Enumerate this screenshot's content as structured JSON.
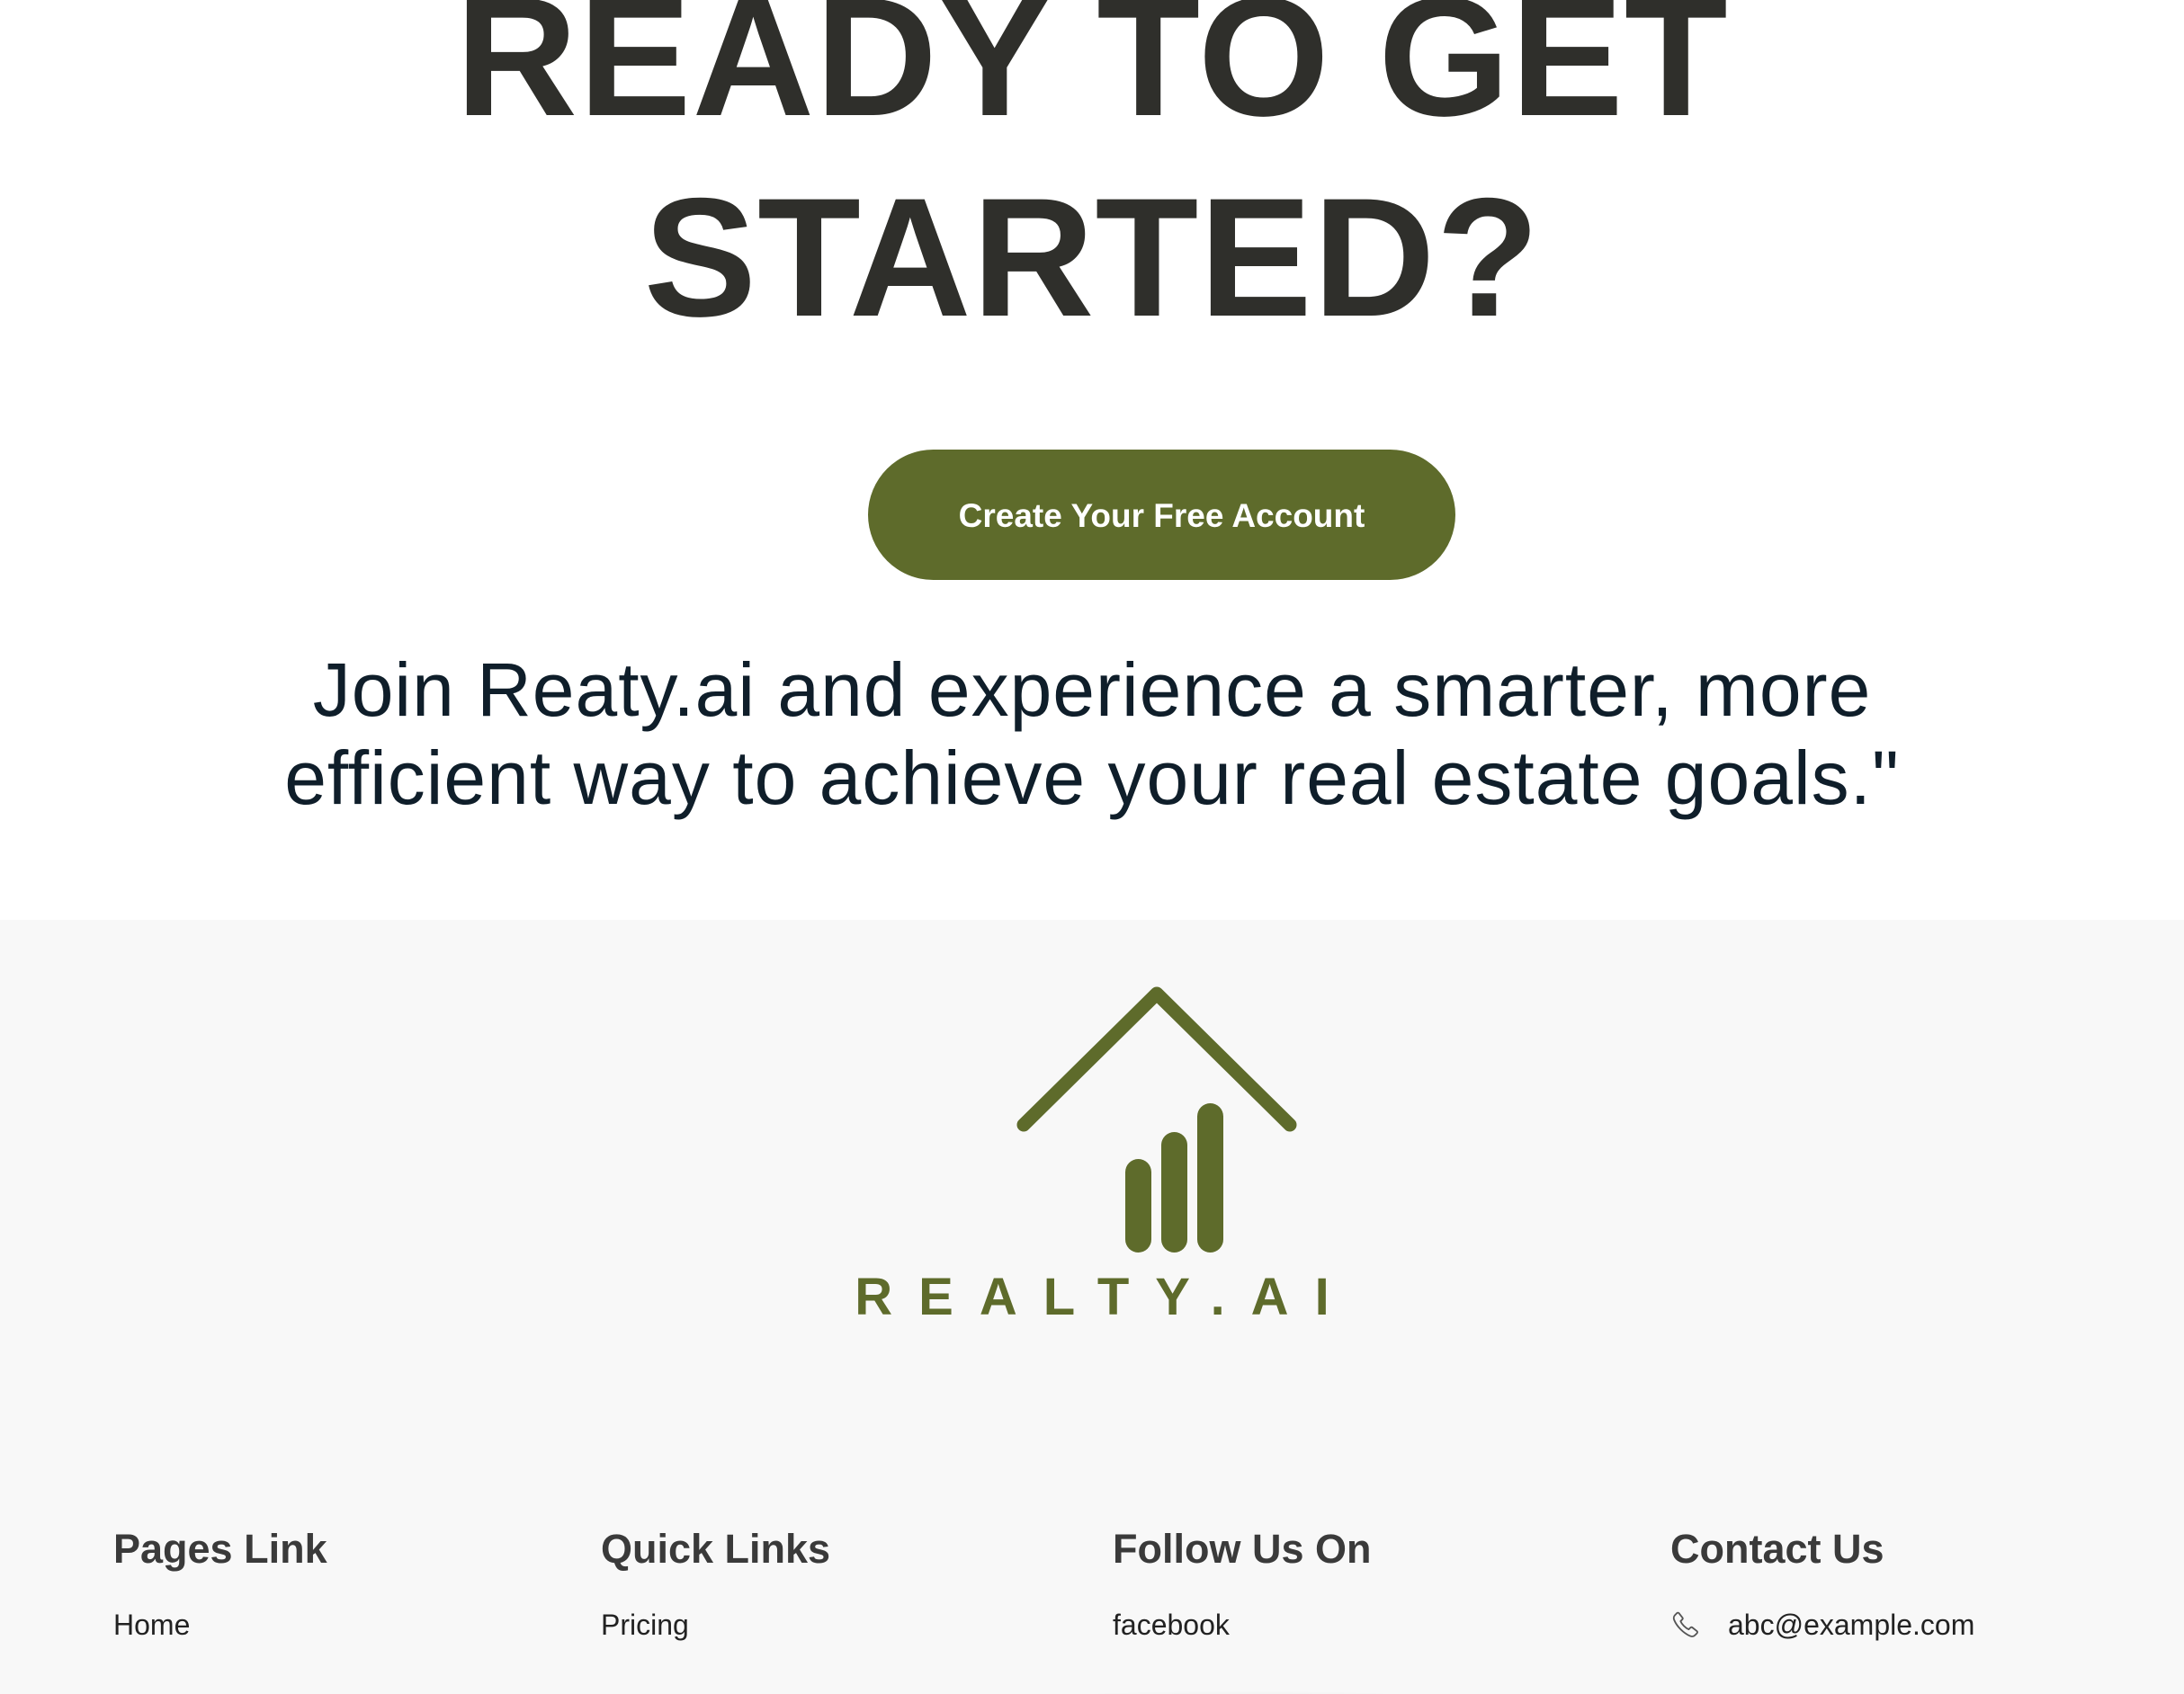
{
  "cta": {
    "heading_line1": "READY TO GET",
    "heading_line2": "STARTED?",
    "button_label": "Create Your Free Account",
    "subtitle_line1": "Join Reaty.ai and experience a smarter, more",
    "subtitle_line2": "efficient way to achieve your real estate goals.\""
  },
  "brand": {
    "name": "REALTY.AI",
    "logo_icon": "house-bar-chart-icon",
    "color": "#5e6b2b"
  },
  "footer": {
    "columns": [
      {
        "title": "Pages Link",
        "links": [
          "Home"
        ]
      },
      {
        "title": "Quick Links",
        "links": [
          "Pricing"
        ]
      },
      {
        "title": "Follow Us On",
        "links": [
          "facebook"
        ]
      },
      {
        "title": "Contact Us",
        "links": [
          "abc@example.com"
        ],
        "icon": "phone-icon"
      }
    ]
  },
  "colors": {
    "accent": "#5e6b2b",
    "heading": "#2f2f2b",
    "subtitle": "#0f1e2a",
    "footer_bg": "#f8f8f8"
  }
}
